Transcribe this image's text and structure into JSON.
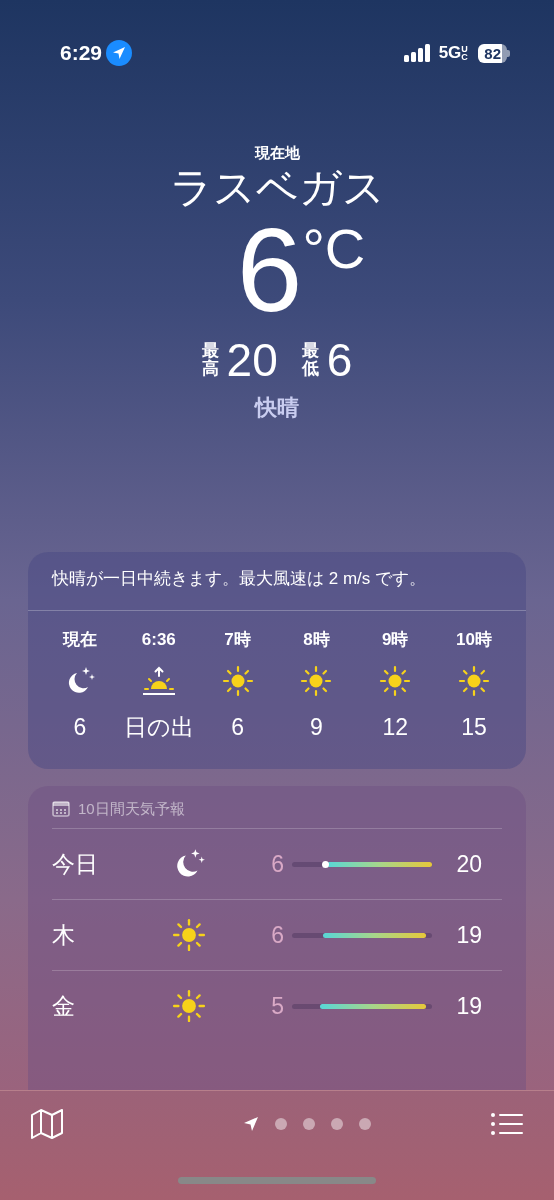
{
  "status_bar": {
    "time": "6:29",
    "network": "5G",
    "network_suffix": "UC",
    "battery": "82",
    "location_active": true
  },
  "header": {
    "label": "現在地",
    "city": "ラスベガス",
    "temperature": "6",
    "unit": "°C",
    "high_label": "最高",
    "high": "20",
    "low_label": "最低",
    "low": "6",
    "condition": "快晴"
  },
  "hourly": {
    "summary": "快晴が一日中続きます。最大風速は 2 m/s です。",
    "items": [
      {
        "time": "現在",
        "kind": "moon",
        "value": "6"
      },
      {
        "time": "6:36",
        "kind": "sunrise",
        "value": "日の出"
      },
      {
        "time": "7時",
        "kind": "sun",
        "value": "6"
      },
      {
        "time": "8時",
        "kind": "sun",
        "value": "9"
      },
      {
        "time": "9時",
        "kind": "sun",
        "value": "12"
      },
      {
        "time": "10時",
        "kind": "sun",
        "value": "15"
      }
    ]
  },
  "daily": {
    "title": "10日間天気予報",
    "days": [
      {
        "day": "今日",
        "kind": "moon",
        "low": "6",
        "high": "20",
        "level": 0.75,
        "current_marker": true
      },
      {
        "day": "木",
        "kind": "sun",
        "low": "6",
        "high": "19",
        "level": 0.74,
        "current_marker": false
      },
      {
        "day": "金",
        "kind": "sun",
        "low": "5",
        "high": "19",
        "level": 0.76,
        "current_marker": false
      }
    ]
  },
  "bottom_bar": {
    "pages": [
      {
        "kind": "location",
        "selected": true
      },
      {
        "kind": "dot",
        "selected": false
      },
      {
        "kind": "dot",
        "selected": false
      },
      {
        "kind": "dot",
        "selected": false
      },
      {
        "kind": "dot",
        "selected": false
      }
    ]
  }
}
